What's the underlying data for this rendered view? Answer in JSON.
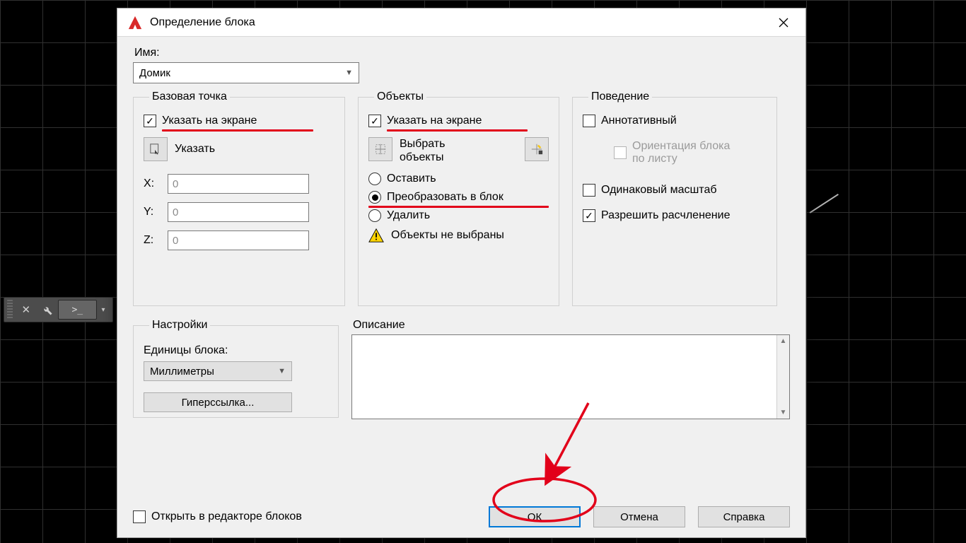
{
  "dialog": {
    "title": "Определение блока",
    "name_label": "Имя:",
    "name_value": "Домик",
    "base_point": {
      "legend": "Базовая точка",
      "specify_on_screen": "Указать на экране",
      "pick_button": "Указать",
      "x_label": "X:",
      "x_value": "0",
      "y_label": "Y:",
      "y_value": "0",
      "z_label": "Z:",
      "z_value": "0"
    },
    "objects": {
      "legend": "Объекты",
      "specify_on_screen": "Указать на экране",
      "select_objects": "Выбрать\nобъекты",
      "retain": "Оставить",
      "convert": "Преобразовать в блок",
      "delete": "Удалить",
      "warning": "Объекты не выбраны"
    },
    "behavior": {
      "legend": "Поведение",
      "annotative": "Аннотативный",
      "orientation": "Ориентация блока\nпо листу",
      "uniform_scale": "Одинаковый масштаб",
      "allow_exploding": "Разрешить расчленение"
    },
    "settings": {
      "legend": "Настройки",
      "units_label": "Единицы блока:",
      "units_value": "Миллиметры",
      "hyperlink": "Гиперссылка..."
    },
    "description": {
      "label": "Описание",
      "value": ""
    },
    "open_in_editor": "Открыть в редакторе блоков",
    "buttons": {
      "ok": "ОК",
      "cancel": "Отмена",
      "help": "Справка"
    }
  },
  "dock": {
    "prompt": ">_"
  }
}
